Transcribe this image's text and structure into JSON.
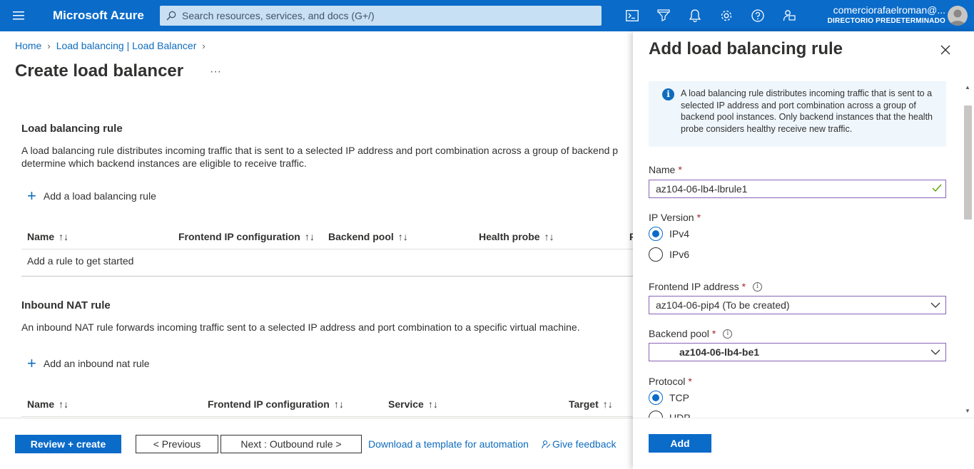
{
  "topbar": {
    "brand": "Microsoft Azure",
    "search_placeholder": "Search resources, services, and docs (G+/)",
    "user": "comerciorafaelroman@...",
    "directory": "DIRECTORIO PREDETERMINADO"
  },
  "breadcrumb": {
    "home": "Home",
    "parent": "Load balancing | Load Balancer"
  },
  "page": {
    "title": "Create load balancer",
    "more": "···"
  },
  "lb_rule": {
    "heading": "Load balancing rule",
    "desc_line1": "A load balancing rule distributes incoming traffic that is sent to a selected IP address and port combination across a group of backend p",
    "desc_line2": "determine which backend instances are eligible to receive traffic.",
    "add_label": "Add a load balancing rule",
    "columns": [
      "Name",
      "Frontend IP configuration",
      "Backend pool",
      "Health probe",
      "F"
    ],
    "empty": "Add a rule to get started"
  },
  "nat_rule": {
    "heading": "Inbound NAT rule",
    "desc": "An inbound NAT rule forwards incoming traffic sent to a selected IP address and port combination to a specific virtual machine.",
    "add_label": "Add an inbound nat rule",
    "columns": [
      "Name",
      "Frontend IP configuration",
      "Service",
      "Target"
    ]
  },
  "footer": {
    "review": "Review + create",
    "previous": "< Previous",
    "next": "Next : Outbound rule >",
    "download": "Download a template for automation",
    "feedback": "Give feedback"
  },
  "panel": {
    "title": "Add load balancing rule",
    "info": "A load balancing rule distributes incoming traffic that is sent to a selected IP address and port combination across a group of backend pool instances. Only backend instances that the health probe considers healthy receive new traffic.",
    "name_label": "Name",
    "name_value": "az104-06-lb4-lbrule1",
    "ipver_label": "IP Version",
    "ipv4": "IPv4",
    "ipv6": "IPv6",
    "frontend_label": "Frontend IP address",
    "frontend_value": "az104-06-pip4 (To be created)",
    "backend_label": "Backend pool",
    "backend_value": "az104-06-lb4-be1",
    "protocol_label": "Protocol",
    "tcp": "TCP",
    "udp": "UDP",
    "add_button": "Add",
    "required_mark": "*"
  }
}
